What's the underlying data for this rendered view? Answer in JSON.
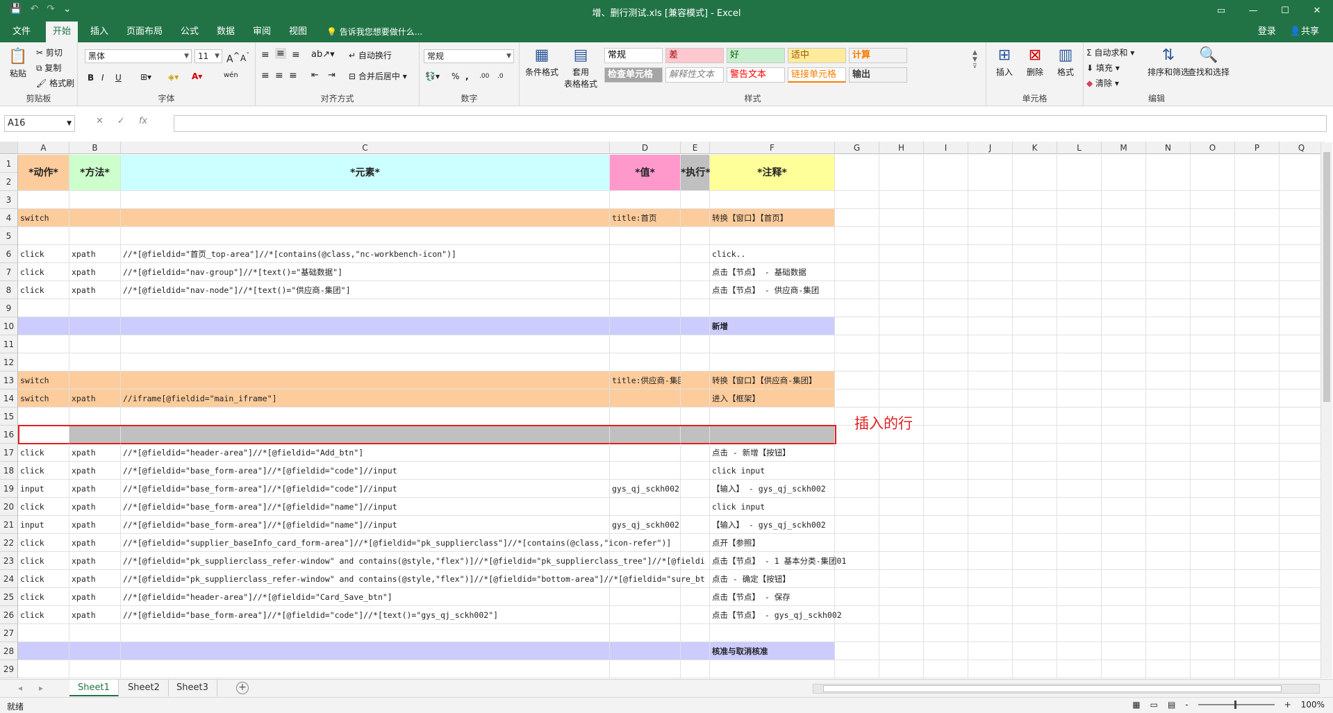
{
  "window": {
    "title": "增、删行测试.xls  [兼容模式] - Excel",
    "controls": [
      "▭",
      "—",
      "☐",
      "✕"
    ]
  },
  "qat": {
    "save": "💾",
    "undo": "↶",
    "redo": "↷",
    "more": "⌄"
  },
  "tabs": [
    "文件",
    "开始",
    "插入",
    "页面布局",
    "公式",
    "数据",
    "审阅",
    "视图"
  ],
  "active_tab": "开始",
  "tell_me": "告诉我您想要做什么...",
  "account": {
    "login": "登录",
    "share": "共享"
  },
  "ribbon": {
    "clipboard": {
      "label": "剪贴板",
      "paste": "粘贴",
      "cut": "剪切",
      "copy": "复制",
      "format_painter": "格式刷"
    },
    "font": {
      "label": "字体",
      "name": "黑体",
      "size": "11",
      "bold": "B",
      "italic": "I",
      "underline": "U",
      "grow": "A",
      "shrink": "A",
      "wen": "wén"
    },
    "alignment": {
      "label": "对齐方式",
      "wrap": "自动换行",
      "merge": "合并后居中"
    },
    "number": {
      "label": "数字",
      "format": "常规",
      "percent": "%",
      "comma": ",",
      "inc_decimal": ".00",
      "dec_decimal": ".0"
    },
    "styles": {
      "label": "样式",
      "cond_format": "条件格式",
      "table_format_1": "套用",
      "table_format_2": "表格格式",
      "cells": [
        {
          "text": "常规",
          "bg": "#ffffff",
          "fg": "#000000"
        },
        {
          "text": "差",
          "bg": "#ffc7ce",
          "fg": "#9c0006"
        },
        {
          "text": "好",
          "bg": "#c6efce",
          "fg": "#006100"
        },
        {
          "text": "适中",
          "bg": "#ffeb9c",
          "fg": "#9c5700"
        },
        {
          "text": "计算",
          "bg": "#f2f2f2",
          "fg": "#fa7d00"
        },
        {
          "text": "检查单元格",
          "bg": "#a5a5a5",
          "fg": "#ffffff"
        },
        {
          "text": "解释性文本",
          "bg": "#ffffff",
          "fg": "#7f7f7f"
        },
        {
          "text": "警告文本",
          "bg": "#ffffff",
          "fg": "#ff0000"
        },
        {
          "text": "链接单元格",
          "bg": "#ffffff",
          "fg": "#fa7d00"
        },
        {
          "text": "输出",
          "bg": "#f2f2f2",
          "fg": "#3f3f3f"
        }
      ]
    },
    "cells_group": {
      "label": "单元格",
      "insert": "插入",
      "delete": "删除",
      "format": "格式"
    },
    "editing": {
      "label": "编辑",
      "autosum": "自动求和",
      "fill": "填充",
      "clear": "清除",
      "sort_filter": "排序和筛选",
      "find_select": "查找和选择"
    }
  },
  "formula_bar": {
    "name_box": "A16",
    "cancel": "✕",
    "enter": "✓",
    "fx": "fx",
    "value": ""
  },
  "columns": [
    "A",
    "B",
    "C",
    "D",
    "E",
    "F",
    "G",
    "H",
    "I",
    "J",
    "K",
    "L",
    "M",
    "N",
    "O",
    "P",
    "Q"
  ],
  "header_row": {
    "a": "*动作*",
    "b": "*方法*",
    "c": "*元素*",
    "d": "*值*",
    "e": "*执行*",
    "f": "*注释*"
  },
  "rows": [
    {
      "n": "3",
      "a": "",
      "b": "",
      "c": "",
      "d": "",
      "e": "",
      "f": ""
    },
    {
      "n": "4",
      "a": "switch",
      "b": "",
      "c": "",
      "d": "title:首页",
      "e": "",
      "f": "转换【窗口】【首页】"
    },
    {
      "n": "5",
      "a": "",
      "b": "",
      "c": "",
      "d": "",
      "e": "",
      "f": ""
    },
    {
      "n": "6",
      "a": "click",
      "b": "xpath",
      "c": "//*[@fieldid=\"首页_top-area\"]//*[contains(@class,\"nc-workbench-icon\")]",
      "d": "",
      "e": "",
      "f": "click.."
    },
    {
      "n": "7",
      "a": "click",
      "b": "xpath",
      "c": "//*[@fieldid=\"nav-group\"]//*[text()=\"基础数据\"]",
      "d": "",
      "e": "",
      "f": "点击【节点】 - 基础数据"
    },
    {
      "n": "8",
      "a": "click",
      "b": "xpath",
      "c": "//*[@fieldid=\"nav-node\"]//*[text()=\"供应商-集团\"]",
      "d": "",
      "e": "",
      "f": "点击【节点】 - 供应商-集团"
    },
    {
      "n": "9",
      "a": "",
      "b": "",
      "c": "",
      "d": "",
      "e": "",
      "f": ""
    },
    {
      "n": "10",
      "a": "",
      "b": "",
      "c": "",
      "d": "",
      "e": "",
      "f": "新增"
    },
    {
      "n": "11",
      "a": "",
      "b": "",
      "c": "",
      "d": "",
      "e": "",
      "f": ""
    },
    {
      "n": "12",
      "a": "",
      "b": "",
      "c": "",
      "d": "",
      "e": "",
      "f": ""
    },
    {
      "n": "13",
      "a": "switch",
      "b": "",
      "c": "",
      "d": "title:供应商-集团",
      "e": "",
      "f": "转换【窗口】【供应商-集团】"
    },
    {
      "n": "14",
      "a": "switch",
      "b": "xpath",
      "c": "//iframe[@fieldid=\"main_iframe\"]",
      "d": "",
      "e": "",
      "f": "进入【框架】"
    },
    {
      "n": "15",
      "a": "",
      "b": "",
      "c": "",
      "d": "",
      "e": "",
      "f": ""
    },
    {
      "n": "16",
      "a": "",
      "b": "",
      "c": "",
      "d": "",
      "e": "",
      "f": ""
    },
    {
      "n": "17",
      "a": "click",
      "b": "xpath",
      "c": "//*[@fieldid=\"header-area\"]//*[@fieldid=\"Add_btn\"]",
      "d": "",
      "e": "",
      "f": "点击 - 新增【按钮】"
    },
    {
      "n": "18",
      "a": "click",
      "b": "xpath",
      "c": "//*[@fieldid=\"base_form-area\"]//*[@fieldid=\"code\"]//input",
      "d": "",
      "e": "",
      "f": "click input"
    },
    {
      "n": "19",
      "a": "input",
      "b": "xpath",
      "c": "//*[@fieldid=\"base_form-area\"]//*[@fieldid=\"code\"]//input",
      "d": "gys_qj_sckh002",
      "e": "",
      "f": "【输入】 - gys_qj_sckh002"
    },
    {
      "n": "20",
      "a": "click",
      "b": "xpath",
      "c": "//*[@fieldid=\"base_form-area\"]//*[@fieldid=\"name\"]//input",
      "d": "",
      "e": "",
      "f": "click input"
    },
    {
      "n": "21",
      "a": "input",
      "b": "xpath",
      "c": "//*[@fieldid=\"base_form-area\"]//*[@fieldid=\"name\"]//input",
      "d": "gys_qj_sckh002",
      "e": "",
      "f": "【输入】 - gys_qj_sckh002"
    },
    {
      "n": "22",
      "a": "click",
      "b": "xpath",
      "c": "//*[@fieldid=\"supplier_baseInfo_card_form-area\"]//*[@fieldid=\"pk_supplierclass\"]//*[contains(@class,\"icon-refer\")]",
      "d": "",
      "e": "",
      "f": "点开【参照】"
    },
    {
      "n": "23",
      "a": "click",
      "b": "xpath",
      "c": "//*[@fieldid=\"pk_supplierclass_refer-window\" and contains(@style,\"flex\")]//*[@fieldid=\"pk_supplierclass_tree\"]//*[@fieldi",
      "d": "",
      "e": "",
      "f": "点击【节点】 - 1 基本分类-集团01"
    },
    {
      "n": "24",
      "a": "click",
      "b": "xpath",
      "c": "//*[@fieldid=\"pk_supplierclass_refer-window\" and contains(@style,\"flex\")]//*[@fieldid=\"bottom-area\"]//*[@fieldid=\"sure_bt",
      "d": "",
      "e": "",
      "f": "点击 - 确定【按钮】"
    },
    {
      "n": "25",
      "a": "click",
      "b": "xpath",
      "c": "//*[@fieldid=\"header-area\"]//*[@fieldid=\"Card_Save_btn\"]",
      "d": "",
      "e": "",
      "f": "点击【节点】 - 保存"
    },
    {
      "n": "26",
      "a": "click",
      "b": "xpath",
      "c": "//*[@fieldid=\"base_form-area\"]//*[@fieldid=\"code\"]//*[text()=\"gys_qj_sckh002\"]",
      "d": "",
      "e": "",
      "f": "点击【节点】 - gys_qj_sckh002"
    },
    {
      "n": "27",
      "a": "",
      "b": "",
      "c": "",
      "d": "",
      "e": "",
      "f": ""
    },
    {
      "n": "28",
      "a": "",
      "b": "",
      "c": "",
      "d": "",
      "e": "",
      "f": "核准与取消核准"
    },
    {
      "n": "29",
      "a": "",
      "b": "",
      "c": "",
      "d": "",
      "e": "",
      "f": ""
    }
  ],
  "annotation": "插入的行",
  "sheets": [
    "Sheet1",
    "Sheet2",
    "Sheet3"
  ],
  "active_sheet": "Sheet1",
  "add_sheet": "+",
  "status": {
    "ready": "就绪",
    "zoom": "100%",
    "zoom_minus": "-",
    "zoom_plus": "+"
  },
  "colors": {
    "excel_green": "#217346",
    "orange_row": "#fdcc9c",
    "lavender_row": "#ccccff",
    "selected_row": "#c0c0c0",
    "highlight_border": "#e02020"
  }
}
